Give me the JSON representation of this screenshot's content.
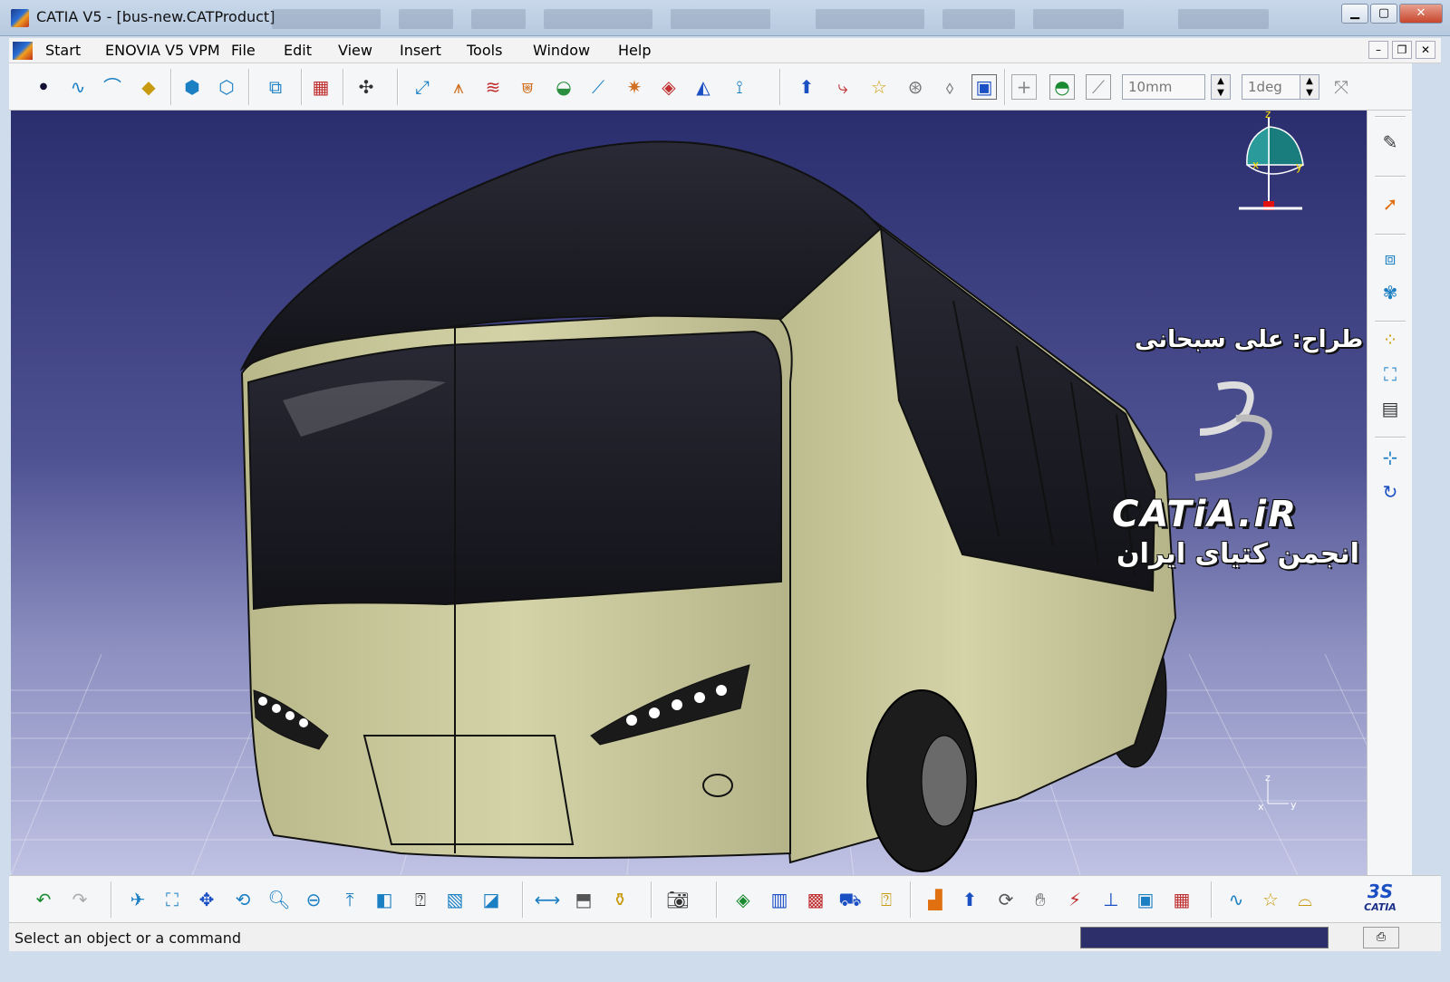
{
  "window": {
    "title": "CATIA V5 - [bus-new.CATProduct]",
    "minimize": "▁",
    "maximize": "▢",
    "close": "✕"
  },
  "menu": {
    "start": "Start",
    "enovia": "ENOVIA V5 VPM",
    "file": "File",
    "edit": "Edit",
    "view": "View",
    "insert": "Insert",
    "tools": "Tools",
    "window": "Window",
    "help": "Help"
  },
  "toolbar_top": {
    "step_field": "10mm",
    "angle_field": "1deg"
  },
  "viewport": {
    "designer_label": "طراح: علی سبحانی",
    "brand_text": "CATiA.iR",
    "association_label": "انجمن کتیای ایران",
    "compass_x": "x",
    "compass_y": "y",
    "compass_z": "z",
    "axis_x": "x",
    "axis_y": "y",
    "axis_z": "z"
  },
  "toolbar_bottom": {
    "catia_logo": "CATIA"
  },
  "status": {
    "message": "Select an object or a command"
  },
  "colors": {
    "bus_body": "#c8c79a",
    "bus_glass": "#1c1c24",
    "viewport_top": "#2b2e6e",
    "viewport_bottom": "#bfc2e3",
    "grid": "#ffffff"
  }
}
